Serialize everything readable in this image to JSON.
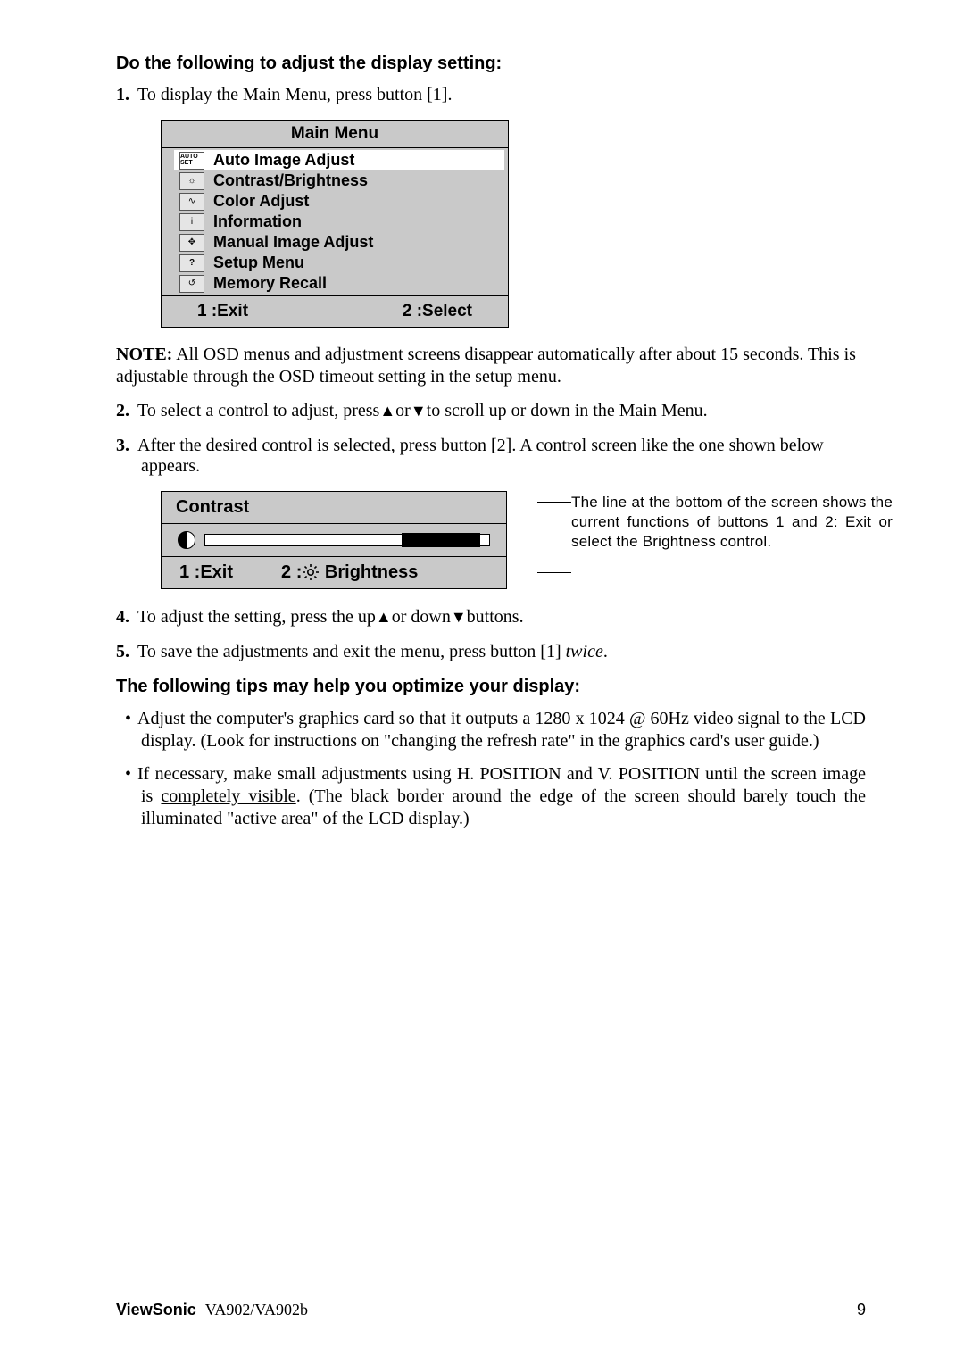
{
  "headings": {
    "h1": "Do the following to adjust the display setting:",
    "tips": "The following tips may help you optimize your display:"
  },
  "steps": {
    "s1_num": "1.",
    "s1_text": "To display the Main Menu, press button [1].",
    "s2_num": "2.",
    "s2_text_a": "To select a control to adjust, press",
    "s2_text_b": "or",
    "s2_text_c": "to scroll up or down in the Main Menu.",
    "s3_num": "3.",
    "s3_text": "After the desired control is selected, press button [2]. A control screen like the one shown below appears.",
    "s4_num": "4.",
    "s4_text_a": "To adjust the setting, press the up",
    "s4_text_b": "or down",
    "s4_text_c": "buttons.",
    "s5_num": "5.",
    "s5_text_a": "To save the adjustments and exit the menu, press button [1] ",
    "s5_text_b": "twice",
    "s5_text_c": "."
  },
  "main_menu": {
    "title": "Main Menu",
    "items": [
      "Auto Image Adjust",
      "Contrast/Brightness",
      "Color Adjust",
      "Information",
      "Manual Image Adjust",
      "Setup Menu",
      "Memory Recall"
    ],
    "icons": [
      "AUTO\nSET",
      "☼",
      "∿",
      "i",
      "✥",
      "?",
      "↺"
    ],
    "footer_left": "1 :Exit",
    "footer_right": "2 :Select"
  },
  "note": {
    "label": "NOTE:",
    "text": " All OSD menus and adjustment screens disappear automatically after about 15 seconds. This is adjustable through the OSD timeout setting in the setup menu."
  },
  "contrast": {
    "title": "Contrast",
    "footer_left": "1 :Exit",
    "footer_right_a": "2 :",
    "footer_right_b": " Brightness"
  },
  "callouts": {
    "line1": "The line at the bottom of the screen shows the current functions of buttons 1 and 2: Exit or select the Brightness control."
  },
  "bullets": {
    "b1": "Adjust the computer's graphics card so that it outputs a 1280 x 1024 @ 60Hz video signal to the LCD display. (Look for instructions on \"changing the refresh rate\" in the graphics card's user guide.)",
    "b2_a": "If necessary, make small adjustments using H. POSITION and V. POSITION until the screen image is ",
    "b2_underline": "completely visible",
    "b2_b": ". (The black border around the edge of the screen should barely touch the illuminated \"active area\" of the LCD display.)"
  },
  "footer": {
    "brand": "ViewSonic",
    "model": "VA902/VA902b",
    "page": "9"
  }
}
